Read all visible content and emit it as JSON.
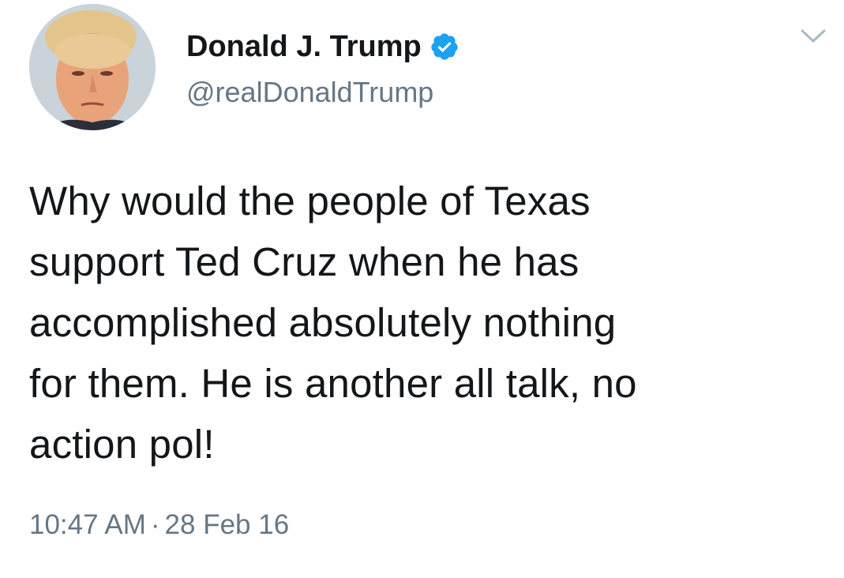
{
  "user": {
    "display_name": "Donald J. Trump",
    "handle": "@realDonaldTrump",
    "verified": true,
    "avatar_icon": "profile-photo"
  },
  "tweet": {
    "text": "Why would the people of Texas\nsupport Ted Cruz when he has\naccomplished absolutely nothing\nfor them. He is another all talk, no\naction pol!",
    "time": "10:47 AM",
    "separator": "·",
    "date": "28 Feb 16"
  },
  "colors": {
    "text": "#14171a",
    "secondary": "#657786",
    "verified_blue": "#1da1f2",
    "background": "#ffffff"
  },
  "icons": {
    "menu": "chevron-down-icon",
    "verified": "verified-badge-icon"
  }
}
